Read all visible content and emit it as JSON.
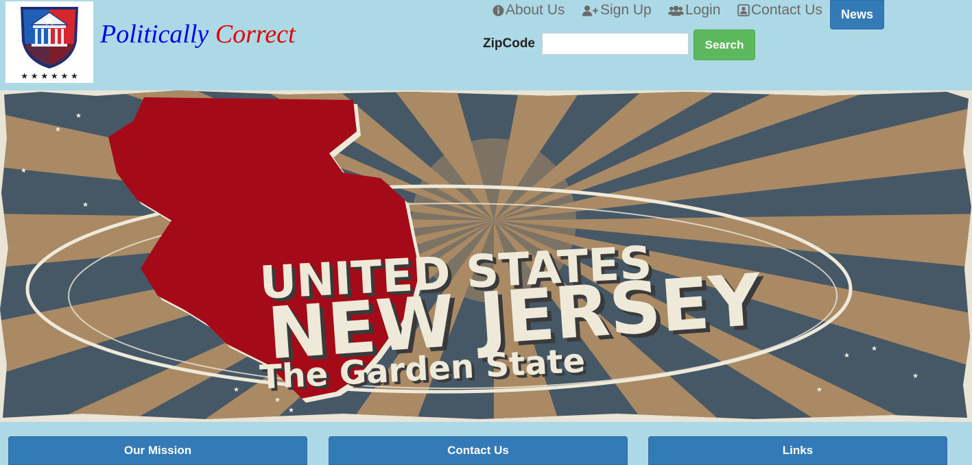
{
  "brand": {
    "part1": "Politically",
    "part2": "Correct"
  },
  "nav": {
    "about": "About Us",
    "signup": "Sign Up",
    "login": "Login",
    "contact": "Contact Us",
    "news": "News"
  },
  "search": {
    "label": "ZipCode",
    "value": "",
    "placeholder": "",
    "button": "Search"
  },
  "banner": {
    "line1": "UNITED STATES",
    "line2": "NEW JERSEY",
    "line3": "The Garden State"
  },
  "panels": [
    "Our Mission",
    "Contact Us",
    "Links"
  ],
  "colors": {
    "background": "#add8e6",
    "primary": "#337ab7",
    "success": "#5cb85c",
    "state_red": "#a40a17",
    "sunburst_tan": "#a98a64",
    "sunburst_slate": "#465766"
  },
  "icons": [
    "shield-logo-icon",
    "info-circle-icon",
    "user-plus-icon",
    "users-icon",
    "contact-card-icon"
  ]
}
